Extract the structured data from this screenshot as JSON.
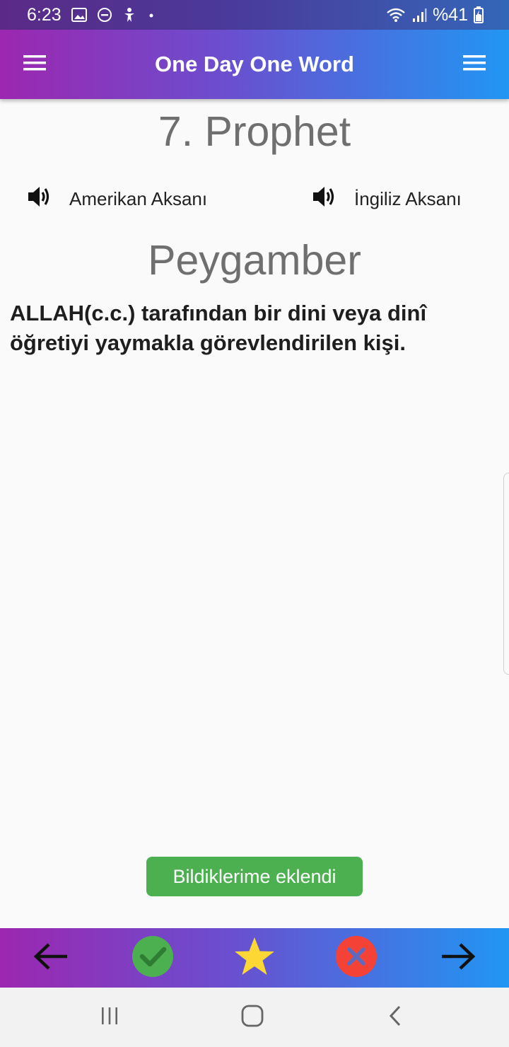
{
  "status_bar": {
    "time": "6:23",
    "battery": "%41",
    "icons": [
      "gallery-icon",
      "do-not-disturb-icon",
      "accessibility-icon",
      "dot-icon",
      "wifi-icon",
      "signal-icon",
      "battery-charging-icon"
    ]
  },
  "app_bar": {
    "title": "One Day One Word",
    "left_icon": "menu-icon",
    "right_icon": "menu-icon"
  },
  "word": {
    "title": "7. Prophet",
    "american_accent_label": "Amerikan Aksanı",
    "british_accent_label": "İngiliz Aksanı",
    "translation": "Peygamber",
    "definition": "ALLAH(c.c.) tarafından bir dini veya dinî öğretiyi yaymakla görevlendirilen kişi."
  },
  "toast": {
    "message": "Bildiklerime eklendi"
  },
  "action_bar": {
    "icons": [
      "arrow-left-icon",
      "check-circle-icon",
      "star-icon",
      "cancel-circle-icon",
      "arrow-right-icon"
    ]
  },
  "colors": {
    "gradient_start": "#9c27b0",
    "gradient_end": "#2196f3",
    "toast_green": "#4caf50",
    "check_green": "#4caf50",
    "star_yellow": "#fdd835",
    "cancel_red": "#f44336"
  },
  "system_nav": {
    "icons": [
      "recent-apps-icon",
      "home-icon",
      "back-icon"
    ]
  }
}
